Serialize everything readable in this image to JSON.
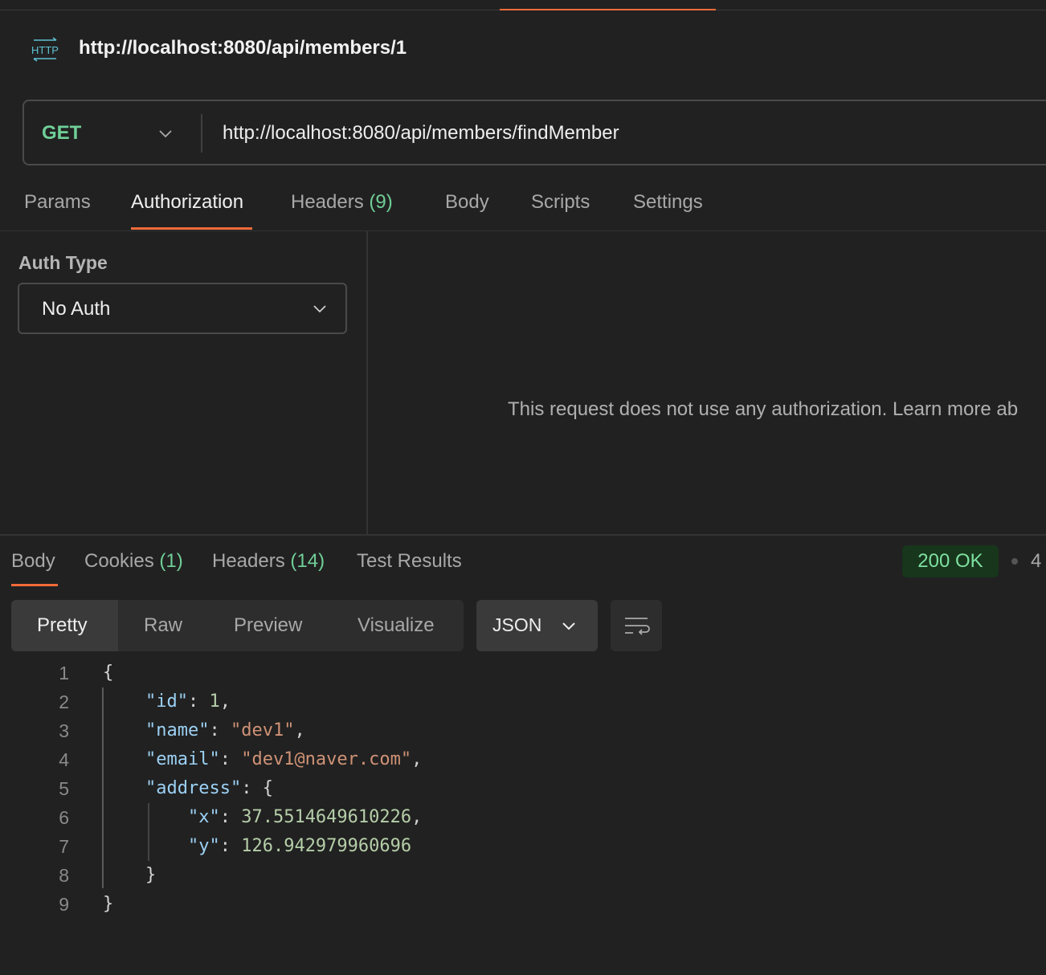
{
  "request": {
    "title": "http://localhost:8080/api/members/1",
    "method": "GET",
    "url": "http://localhost:8080/api/members/findMember",
    "method_color": "#6fcf97"
  },
  "request_tabs": [
    {
      "label": "Params"
    },
    {
      "label": "Authorization",
      "active": true
    },
    {
      "label": "Headers",
      "count": "(9)"
    },
    {
      "label": "Body"
    },
    {
      "label": "Scripts"
    },
    {
      "label": "Settings"
    }
  ],
  "auth": {
    "label": "Auth Type",
    "value": "No Auth",
    "message": "This request does not use any authorization. Learn more ab"
  },
  "response_tabs": [
    {
      "label": "Body",
      "active": true
    },
    {
      "label": "Cookies",
      "count": "(1)"
    },
    {
      "label": "Headers",
      "count": "(14)"
    },
    {
      "label": "Test Results"
    }
  ],
  "response_status": {
    "text": "200 OK",
    "time_partial": "4",
    "color": "#7ee0a0"
  },
  "view_modes": [
    "Pretty",
    "Raw",
    "Preview",
    "Visualize"
  ],
  "format": "JSON",
  "code_lines": [
    {
      "n": "1",
      "tokens": [
        [
          "p",
          "{"
        ]
      ]
    },
    {
      "n": "2",
      "tokens": [
        [
          "p",
          "    "
        ],
        [
          "k",
          "\"id\""
        ],
        [
          "p",
          ": "
        ],
        [
          "n",
          "1"
        ],
        [
          "p",
          ","
        ]
      ]
    },
    {
      "n": "3",
      "tokens": [
        [
          "p",
          "    "
        ],
        [
          "k",
          "\"name\""
        ],
        [
          "p",
          ": "
        ],
        [
          "s",
          "\"dev1\""
        ],
        [
          "p",
          ","
        ]
      ]
    },
    {
      "n": "4",
      "tokens": [
        [
          "p",
          "    "
        ],
        [
          "k",
          "\"email\""
        ],
        [
          "p",
          ": "
        ],
        [
          "s",
          "\"dev1@naver.com\""
        ],
        [
          "p",
          ","
        ]
      ]
    },
    {
      "n": "5",
      "tokens": [
        [
          "p",
          "    "
        ],
        [
          "k",
          "\"address\""
        ],
        [
          "p",
          ": {"
        ]
      ]
    },
    {
      "n": "6",
      "tokens": [
        [
          "p",
          "        "
        ],
        [
          "k",
          "\"x\""
        ],
        [
          "p",
          ": "
        ],
        [
          "n",
          "37.5514649610226"
        ],
        [
          "p",
          ","
        ]
      ]
    },
    {
      "n": "7",
      "tokens": [
        [
          "p",
          "        "
        ],
        [
          "k",
          "\"y\""
        ],
        [
          "p",
          ": "
        ],
        [
          "n",
          "126.942979960696"
        ]
      ]
    },
    {
      "n": "8",
      "tokens": [
        [
          "p",
          "    }"
        ]
      ]
    },
    {
      "n": "9",
      "tokens": [
        [
          "p",
          "}"
        ]
      ]
    }
  ]
}
